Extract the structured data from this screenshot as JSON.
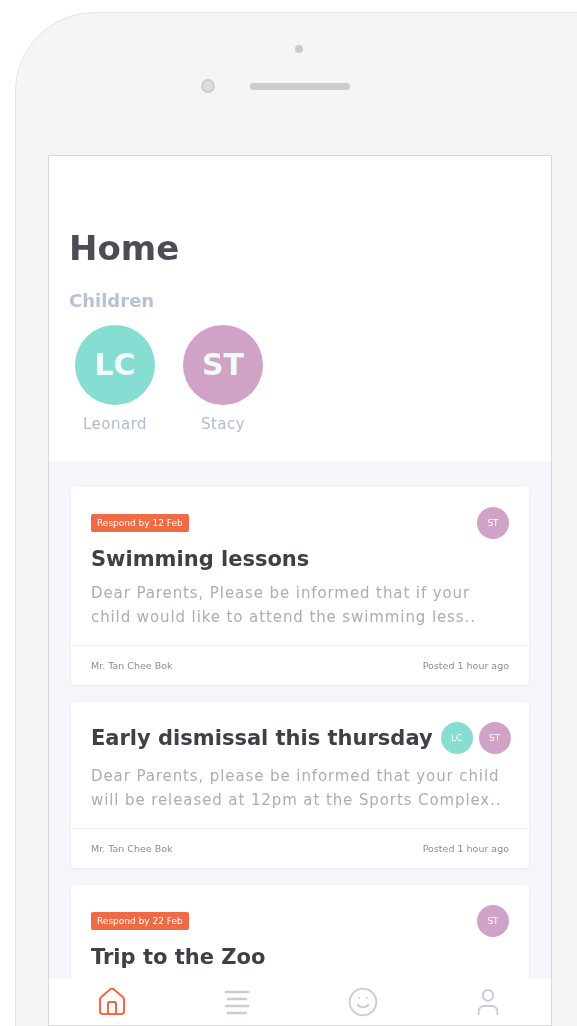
{
  "title": "Home",
  "children_label": "Children",
  "children": [
    {
      "initials": "LC",
      "name": "Leonard",
      "color": "#86ded2"
    },
    {
      "initials": "ST",
      "name": "Stacy",
      "color": "#d0a3c6"
    }
  ],
  "posts": [
    {
      "tag": "Respond by 12 Feb",
      "title": "Swimming lessons",
      "body": "Dear Parents, Please be informed that if your child would like to attend the swimming less..",
      "author": "Mr. Tan Chee Bok",
      "time": "Posted 1 hour ago",
      "avatars": [
        {
          "initials": "ST",
          "color": "#d0a3c6"
        }
      ]
    },
    {
      "title": "Early dismissal this thursday",
      "body": "Dear Parents, please be informed that your child will be released at 12pm at the Sports Complex..",
      "author": "Mr. Tan Chee Bok",
      "time": "Posted 1 hour ago",
      "avatars": [
        {
          "initials": "LC",
          "color": "#86ded2"
        },
        {
          "initials": "ST",
          "color": "#d0a3c6"
        }
      ]
    },
    {
      "tag": "Respond by 22 Feb",
      "title": "Trip to the Zoo",
      "avatars": [
        {
          "initials": "ST",
          "color": "#d0a3c6"
        }
      ]
    }
  ],
  "nav": [
    {
      "kind": "home",
      "selected": true
    },
    {
      "kind": "list",
      "selected": false
    },
    {
      "kind": "smile",
      "selected": false
    },
    {
      "kind": "user",
      "selected": false
    }
  ]
}
